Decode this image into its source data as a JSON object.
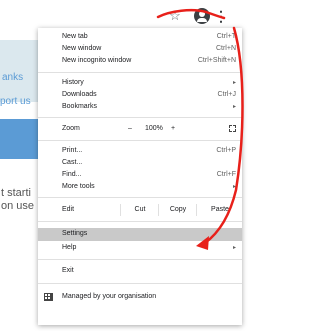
{
  "toolbar": {
    "star_icon": "star-icon",
    "profile_icon": "profile-icon",
    "menu_icon": "kebab-menu-icon"
  },
  "background_page": {
    "text1": "anks",
    "text2": "port us",
    "text3": "t starti",
    "text4": "on use"
  },
  "menu": {
    "new_tab": {
      "label": "New tab",
      "shortcut": "Ctrl+T"
    },
    "new_window": {
      "label": "New window",
      "shortcut": "Ctrl+N"
    },
    "new_incognito": {
      "label": "New incognito window",
      "shortcut": "Ctrl+Shift+N"
    },
    "history": {
      "label": "History"
    },
    "downloads": {
      "label": "Downloads",
      "shortcut": "Ctrl+J"
    },
    "bookmarks": {
      "label": "Bookmarks"
    },
    "zoom": {
      "label": "Zoom",
      "minus": "–",
      "value": "100%",
      "plus": "+"
    },
    "print": {
      "label": "Print...",
      "shortcut": "Ctrl+P"
    },
    "cast": {
      "label": "Cast..."
    },
    "find": {
      "label": "Find...",
      "shortcut": "Ctrl+F"
    },
    "more_tools": {
      "label": "More tools"
    },
    "edit": {
      "label": "Edit",
      "cut": "Cut",
      "copy": "Copy",
      "paste": "Paste"
    },
    "settings": {
      "label": "Settings"
    },
    "help": {
      "label": "Help"
    },
    "exit": {
      "label": "Exit"
    },
    "managed": {
      "label": "Managed by your organisation"
    }
  },
  "colors": {
    "highlight": "#c9c9c9",
    "annotation": "#e8201a",
    "page_accent": "#5b9bd5"
  }
}
